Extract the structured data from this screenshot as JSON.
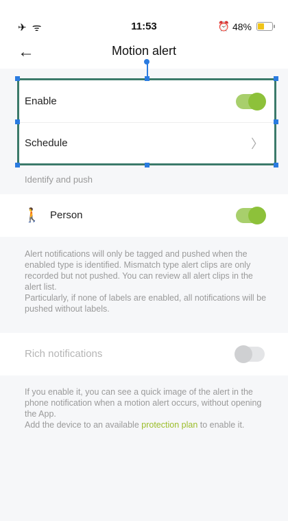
{
  "status_bar": {
    "left_icons": "✈ ᯤ",
    "time": "11:53",
    "battery_percent": "48%",
    "battery_level": 0.48
  },
  "nav": {
    "title": "Motion alert"
  },
  "settings": {
    "enable_label": "Enable",
    "enable_on": true,
    "schedule_label": "Schedule"
  },
  "identify": {
    "section_label": "Identify and push",
    "person_label": "Person",
    "person_on": true,
    "info_line1": "Alert notifications will only be tagged and pushed when the enabled type is identified. Mismatch type alert clips are only recorded but not pushed. You can review all alert clips in the alert list.",
    "info_line2": "Particularly, if none of labels are enabled, all notifications will be pushed without labels."
  },
  "rich": {
    "label": "Rich notifications",
    "on": false,
    "info_line1": "If you enable it, you can see a quick image of the alert in the phone notification when a motion alert occurs, without opening the App.",
    "info_prefix": "Add the device to an available ",
    "info_link": "protection plan",
    "info_suffix": " to enable it."
  },
  "colors": {
    "accent": "#8dc13a",
    "selection": "#2a7be0"
  }
}
